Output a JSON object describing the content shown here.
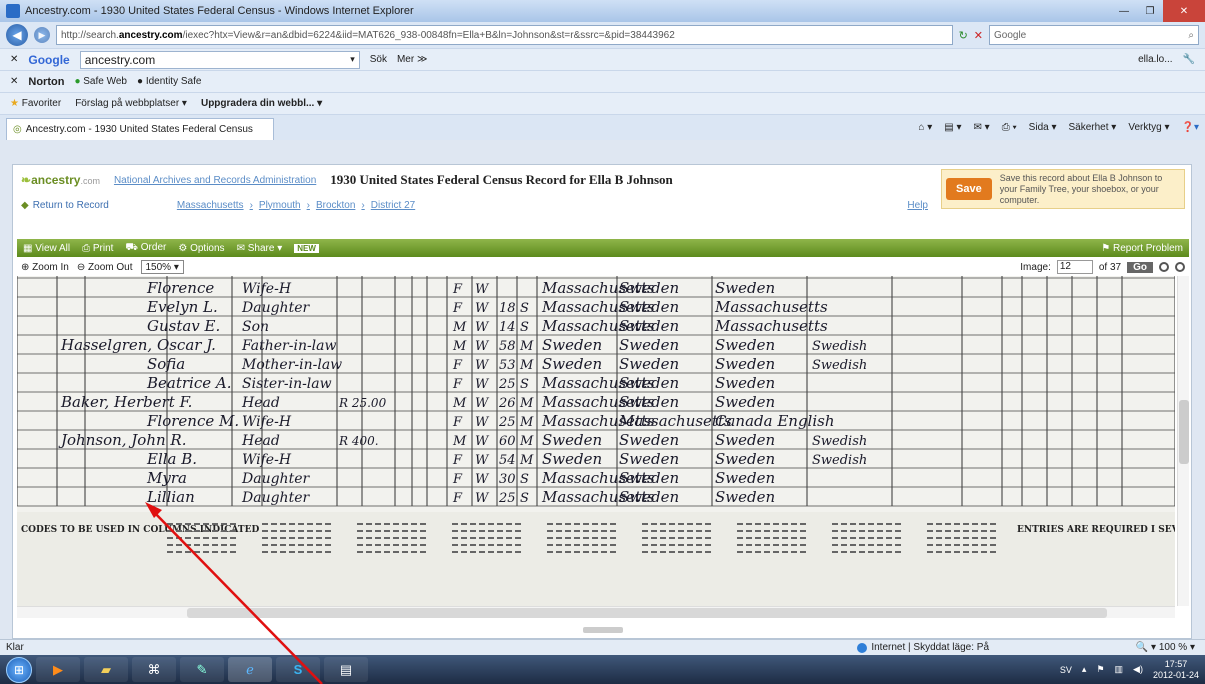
{
  "window": {
    "title": "Ancestry.com - 1930 United States Federal Census - Windows Internet Explorer"
  },
  "address": {
    "url_prefix": "http://search.",
    "url_domain": "ancestry.com",
    "url_rest": "/iexec?htx=View&r=an&dbid=6224&iid=MAT626_938-00848fn=Ella+B&ln=Johnson&st=r&ssrc=&pid=38443962",
    "search_placeholder": "Google"
  },
  "google_toolbar": {
    "brand": "Google",
    "query": "ancestry.com",
    "search_btn": "Sök",
    "more": "Mer ≫",
    "user": "ella.lo..."
  },
  "norton_toolbar": {
    "brand": "Norton",
    "safe_web": "Safe Web",
    "identity_safe": "Identity Safe"
  },
  "favorites_bar": {
    "favorites": "Favoriter",
    "suggested": "Förslag på webbplatser",
    "upgrade": "Uppgradera din webbl..."
  },
  "tab": {
    "label": "Ancestry.com - 1930 United States Federal Census"
  },
  "ie_commands": {
    "page": "Sida",
    "safety": "Säkerhet",
    "tools": "Verktyg"
  },
  "ancestry": {
    "logo_word": "ancestry",
    "logo_com": ".com",
    "collection_link": "National Archives and Records Administration",
    "record_title": "1930 United States Federal Census Record for Ella B Johnson",
    "return_link": "Return to Record",
    "breadcrumb": [
      "Massachusetts",
      "Plymouth",
      "Brockton",
      "District 27"
    ],
    "help": "Help",
    "save_btn": "Save",
    "save_text": "Save this record about Ella B Johnson to your Family Tree, your shoebox, or your computer."
  },
  "viewer": {
    "view_all": "View All",
    "print": "Print",
    "order": "Order",
    "options": "Options",
    "share": "Share",
    "new_badge": "NEW",
    "report": "Report Problem",
    "zoom_in": "Zoom In",
    "zoom_out": "Zoom Out",
    "zoom_level": "150%",
    "image_label": "Image:",
    "image_num": "12",
    "image_total": "of 37",
    "go": "Go"
  },
  "census_rows": [
    {
      "name": "Florence",
      "relation": "Wife-H",
      "sex": "F",
      "race": "W",
      "birthplace": "Massachusetts",
      "father": "Sweden",
      "mother": "Sweden"
    },
    {
      "name": "Evelyn L.",
      "relation": "Daughter",
      "sex": "F",
      "race": "W",
      "age": "18",
      "marital": "S",
      "birthplace": "Massachusetts",
      "father": "Sweden",
      "mother": "Massachusetts"
    },
    {
      "name": "Gustav E.",
      "relation": "Son",
      "sex": "M",
      "race": "W",
      "age": "14",
      "marital": "S",
      "birthplace": "Massachusetts",
      "father": "Sweden",
      "mother": "Massachusetts"
    },
    {
      "name": "Hasselgren, Oscar J.",
      "relation": "Father-in-law",
      "sex": "M",
      "race": "W",
      "age": "58",
      "marital": "M",
      "birthplace": "Sweden",
      "father": "Sweden",
      "mother": "Sweden",
      "lang": "Swedish"
    },
    {
      "name": "Sofia",
      "relation": "Mother-in-law",
      "sex": "F",
      "race": "W",
      "age": "53",
      "marital": "M",
      "birthplace": "Sweden",
      "father": "Sweden",
      "mother": "Sweden",
      "lang": "Swedish"
    },
    {
      "name": "Beatrice A.",
      "relation": "Sister-in-law",
      "sex": "F",
      "race": "W",
      "age": "25",
      "marital": "S",
      "birthplace": "Massachusetts",
      "father": "Sweden",
      "mother": "Sweden"
    },
    {
      "name": "Baker, Herbert F.",
      "relation": "Head",
      "value": "R 25.00",
      "sex": "M",
      "race": "W",
      "age": "26",
      "marital": "M",
      "birthplace": "Massachusetts",
      "father": "Sweden",
      "mother": "Sweden"
    },
    {
      "name": "Florence M.",
      "relation": "Wife-H",
      "sex": "F",
      "race": "W",
      "age": "25",
      "marital": "M",
      "birthplace": "Massachusetts",
      "father": "Massachusetts",
      "mother": "Canada English"
    },
    {
      "name": "Johnson, John R.",
      "relation": "Head",
      "value": "R 400.",
      "sex": "M",
      "race": "W",
      "age": "60",
      "marital": "M",
      "birthplace": "Sweden",
      "father": "Sweden",
      "mother": "Sweden",
      "lang": "Swedish"
    },
    {
      "name": "Ella B.",
      "relation": "Wife-H",
      "sex": "F",
      "race": "W",
      "age": "54",
      "marital": "M",
      "birthplace": "Sweden",
      "father": "Sweden",
      "mother": "Sweden",
      "lang": "Swedish"
    },
    {
      "name": "Myra",
      "relation": "Daughter",
      "sex": "F",
      "race": "W",
      "age": "30",
      "marital": "S",
      "birthplace": "Massachusetts",
      "father": "Sweden",
      "mother": "Sweden"
    },
    {
      "name": "Lillian",
      "relation": "Daughter",
      "sex": "F",
      "race": "W",
      "age": "25",
      "marital": "S",
      "birthplace": "Massachusetts",
      "father": "Sweden",
      "mother": "Sweden"
    }
  ],
  "census_footer": {
    "left": "CODES TO BE USED IN COLUMNS INDICATED",
    "right": "ENTRIES ARE REQUIRED I SEVERAL COLUMNS AS"
  },
  "status": {
    "left": "Klar",
    "zone": "Internet | Skyddat läge: På",
    "zoom": "100 %"
  },
  "taskbar": {
    "lang": "SV",
    "time": "17:57",
    "date": "2012-01-24"
  },
  "colors": {
    "ancestry_green": "#6b8e23",
    "save_orange": "#e27a1e",
    "annotation_arrow": "#e01010"
  }
}
